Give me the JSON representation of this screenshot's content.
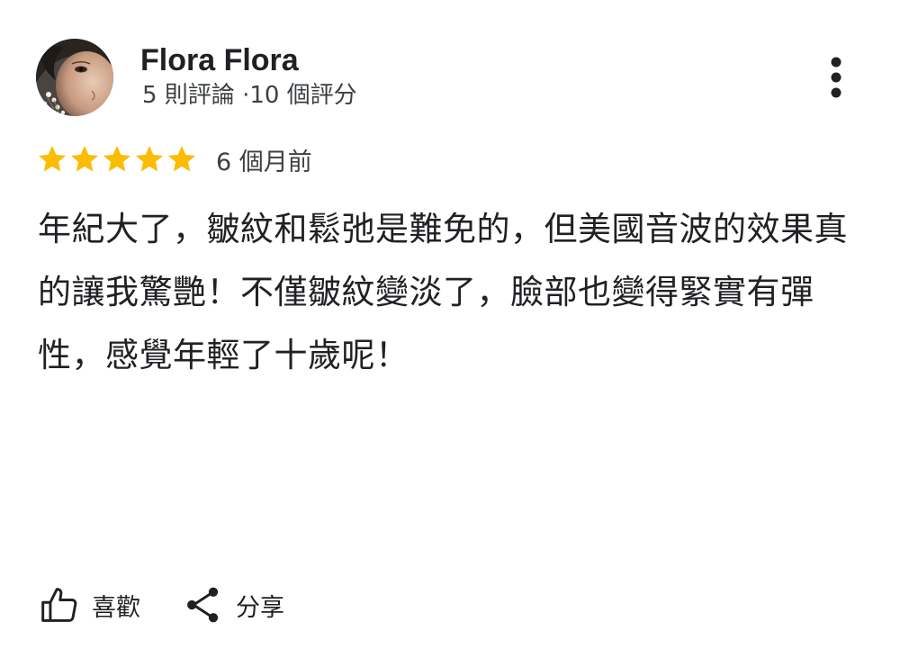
{
  "review": {
    "reviewer_name": "Flora Flora",
    "reviewer_stats": "5 則評論 ·10 個評分",
    "rating": 5,
    "rating_max": 5,
    "star_color": "#FBBC04",
    "time_ago": "6 個月前",
    "text": "年紀大了，皺紋和鬆弛是難免的，但美國音波的效果真的讓我驚艷！不僅皺紋變淡了，臉部也變得緊實有彈性，感覺年輕了十歲呢！"
  },
  "actions": {
    "like_label": "喜歡",
    "share_label": "分享"
  },
  "icons": {
    "more": "more-vert-icon",
    "like": "thumbs-up-icon",
    "share": "share-icon",
    "star": "star-icon"
  }
}
